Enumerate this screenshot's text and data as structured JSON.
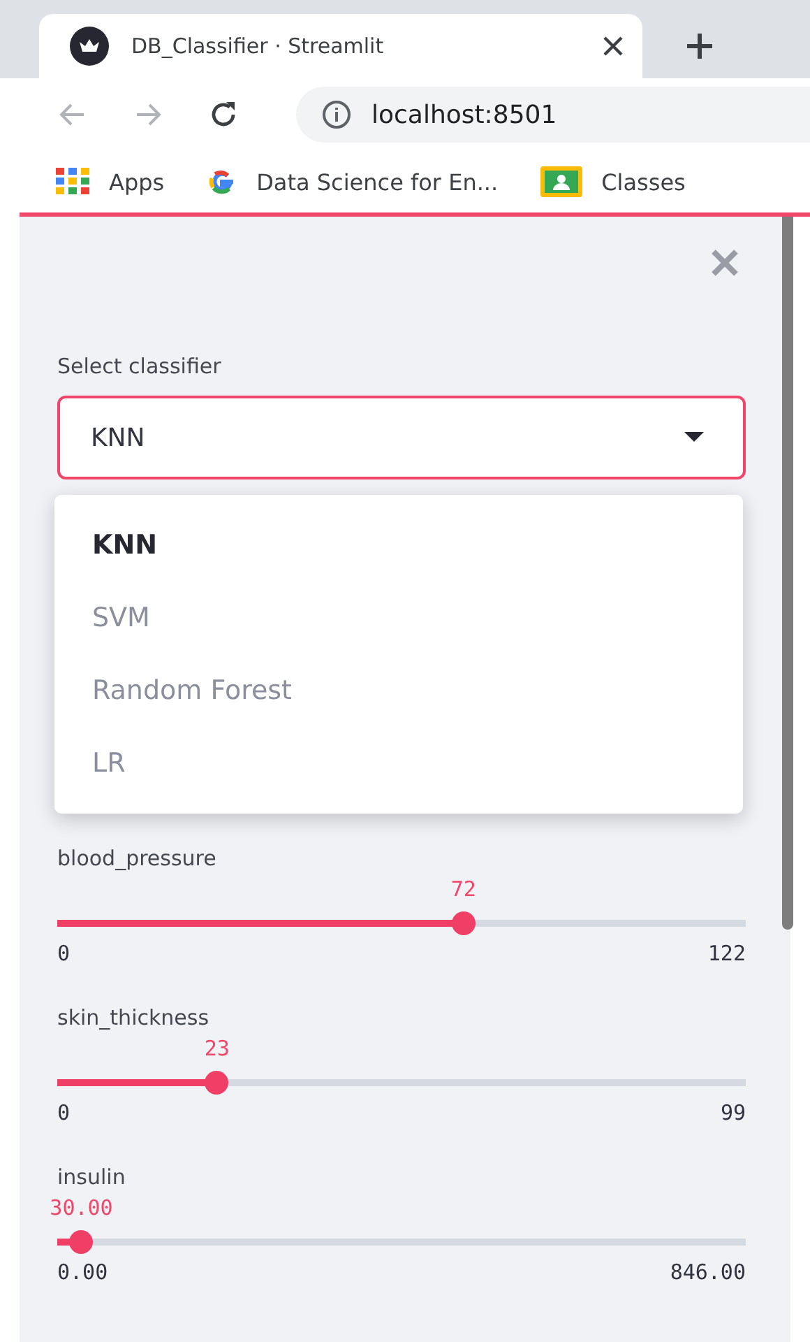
{
  "browser": {
    "tab": {
      "title": "DB_Classifier · Streamlit"
    },
    "url": "localhost:8501",
    "bookmarks": [
      {
        "label": "Apps",
        "kind": "apps"
      },
      {
        "label": "Data Science for En...",
        "kind": "google"
      },
      {
        "label": "Classes",
        "kind": "classroom"
      }
    ]
  },
  "sidebar": {
    "select": {
      "label": "Select classifier",
      "value": "KNN",
      "expanded": true,
      "options": [
        {
          "label": "KNN",
          "selected": true
        },
        {
          "label": "SVM",
          "selected": false
        },
        {
          "label": "Random Forest",
          "selected": false
        },
        {
          "label": "LR",
          "selected": false
        }
      ]
    },
    "sliders": [
      {
        "label": "blood_pressure",
        "value": "72",
        "min": "0",
        "max": "122",
        "level": 0.59
      },
      {
        "label": "skin_thickness",
        "value": "23",
        "min": "0",
        "max": "99",
        "level": 0.232
      },
      {
        "label": "insulin",
        "value": "30.00",
        "min": "0.00",
        "max": "846.00",
        "level": 0.035
      }
    ]
  }
}
